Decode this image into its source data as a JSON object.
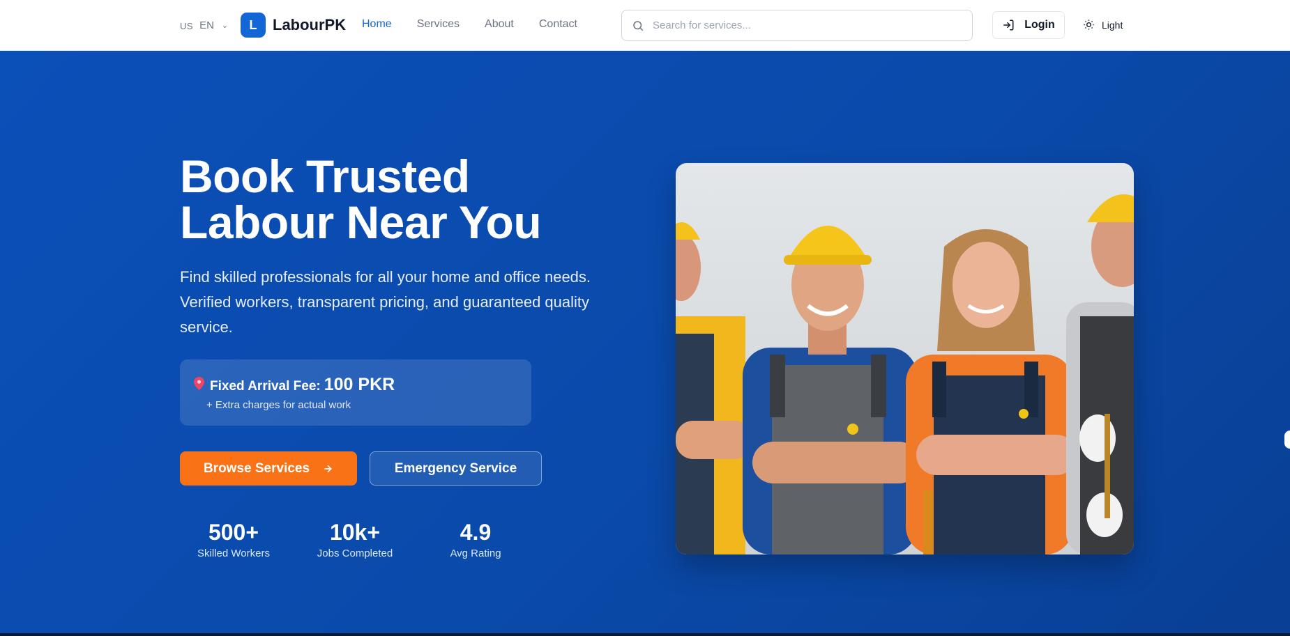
{
  "header": {
    "lang_flag": "US",
    "lang_code": "EN",
    "logo_letter": "L",
    "brand": "LabourPK",
    "nav": [
      {
        "label": "Home",
        "active": true
      },
      {
        "label": "Services",
        "active": false
      },
      {
        "label": "About",
        "active": false
      },
      {
        "label": "Contact",
        "active": false
      }
    ],
    "search_placeholder": "Search for services...",
    "login_label": "Login",
    "theme_label": "Light"
  },
  "hero": {
    "title_line1": "Book Trusted",
    "title_line2": "Labour Near You",
    "description": "Find skilled professionals for all your home and office needs. Verified workers, transparent pricing, and guaranteed quality service.",
    "fee_label": "Fixed Arrival Fee:",
    "fee_value": "100 PKR",
    "fee_note": "+ Extra charges for actual work",
    "browse_label": "Browse Services",
    "emergency_label": "Emergency Service",
    "stats": [
      {
        "value": "500+",
        "label": "Skilled Workers"
      },
      {
        "value": "10k+",
        "label": "Jobs Completed"
      },
      {
        "value": "4.9",
        "label": "Avg Rating"
      }
    ]
  },
  "colors": {
    "brand_blue": "#1366d6",
    "hero_blue": "#0b4fb8",
    "accent_orange": "#f97316"
  },
  "icons": [
    "chevron-down-icon",
    "search-icon",
    "login-icon",
    "sun-icon",
    "map-pin-icon",
    "arrow-right-icon"
  ]
}
